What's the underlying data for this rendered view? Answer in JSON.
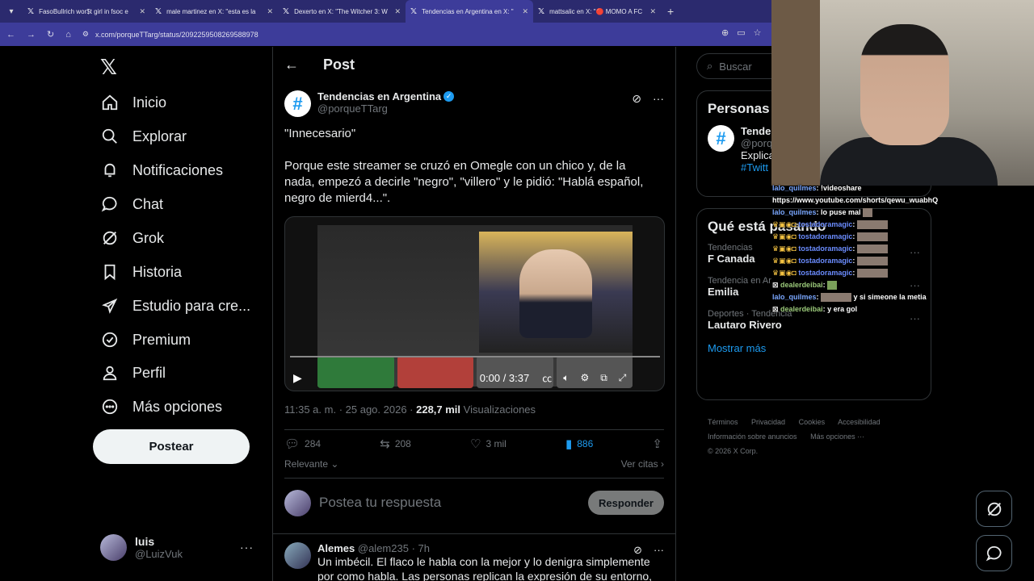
{
  "browser": {
    "tabs": [
      {
        "title": "FasoBullrich wor$t girl in fsoc e",
        "active": false
      },
      {
        "title": "male martinez en X: \"esta es la",
        "active": false
      },
      {
        "title": "Dexerto en X: \"The Witcher 3: W",
        "active": false
      },
      {
        "title": "Tendencias en Argentina en X: \"",
        "active": true
      },
      {
        "title": "mattsalic en X: \"🔴 MOMO A FC",
        "active": false
      }
    ],
    "url": "x.com/porqueTTarg/status/2092259508269588978"
  },
  "sidebar": {
    "items": [
      {
        "label": "Inicio",
        "icon": "home-icon"
      },
      {
        "label": "Explorar",
        "icon": "search-icon"
      },
      {
        "label": "Notificaciones",
        "icon": "bell-icon"
      },
      {
        "label": "Chat",
        "icon": "chat-icon"
      },
      {
        "label": "Grok",
        "icon": "grok-icon"
      },
      {
        "label": "Historia",
        "icon": "bookmark-icon"
      },
      {
        "label": "Estudio para cre...",
        "icon": "rocket-icon"
      },
      {
        "label": "Premium",
        "icon": "verified-badge-icon"
      },
      {
        "label": "Perfil",
        "icon": "person-icon"
      },
      {
        "label": "Más opciones",
        "icon": "more-circle-icon"
      }
    ],
    "post_label": "Postear",
    "profile": {
      "name": "luis",
      "handle": "@LuizVuk"
    }
  },
  "main": {
    "header_title": "Post",
    "tweet": {
      "author_name": "Tendencias en Argentina",
      "author_handle": "@porqueTTarg",
      "text_line1": "\"Innecesario\"",
      "text_line2": "Porque este streamer se cruzó en Omegle con un chico y, de la nada, empezó a decirle \"negro\", \"villero\" y le pidió: \"Hablá español, negro de mierd4...\".",
      "video_time": "0:00 / 3:37",
      "video_progress": 0.0,
      "time": "11:35 a. m.",
      "date": "25 ago. 2026",
      "views": "228,7 mil",
      "views_label": "Visualizaciones",
      "replies": "284",
      "reposts": "208",
      "likes": "3 mil",
      "bookmarks": "886",
      "sort_label": "Relevante",
      "quotes_label": "Ver citas"
    },
    "reply_placeholder": "Postea tu respuesta",
    "reply_button": "Responder",
    "first_reply": {
      "name": "Alemes",
      "handle": "@alem235",
      "time": "· 7h",
      "text": "Un imbécil. El flaco le habla con la mejor y lo denigra simplemente por como habla. Las personas replican la expresión de su entorno, si el pibe"
    }
  },
  "right": {
    "search_placeholder": "Buscar",
    "who_title": "Personas",
    "who": {
      "name": "Tende",
      "handle": "@porq",
      "bio": "Explica",
      "tag": "#Twitt"
    },
    "trends_title": "Qué está pasando",
    "trends": [
      {
        "category": "Tendencias",
        "title": "F Canada"
      },
      {
        "category": "Tendencia en Ar",
        "title": "Emilia"
      },
      {
        "category": "Deportes · Tendencia",
        "title": "Lautaro Rivero"
      }
    ],
    "show_more": "Mostrar más",
    "footer": [
      "Términos",
      "Privacidad",
      "Cookies",
      "Accesibilidad",
      "Información sobre anuncios",
      "Más opciones ···",
      "© 2026 X Corp."
    ]
  },
  "stream_chat": [
    {
      "user": "lalo_quilmes",
      "msg": "!videoshare"
    },
    {
      "user": "",
      "msg": "https://www.youtube.com/shorts/qewu_wuabhQ"
    },
    {
      "user": "lalo_quilmes",
      "msg": "lo puse mal"
    },
    {
      "user": "tostadoramagic",
      "msg": ""
    },
    {
      "user": "tostadoramagic",
      "msg": ""
    },
    {
      "user": "tostadoramagic",
      "msg": ""
    },
    {
      "user": "tostadoramagic",
      "msg": ""
    },
    {
      "user": "tostadoramagic",
      "msg": ""
    },
    {
      "user": "dealerdeibai",
      "msg": ""
    },
    {
      "user": "lalo_quilmes",
      "msg": "y si simeone la metia"
    },
    {
      "user": "dealerdeibai",
      "msg": "y era gol"
    }
  ],
  "colors": {
    "accent": "#1d9bf0",
    "browser_bar": "#3d3c9a",
    "background": "#000000"
  }
}
